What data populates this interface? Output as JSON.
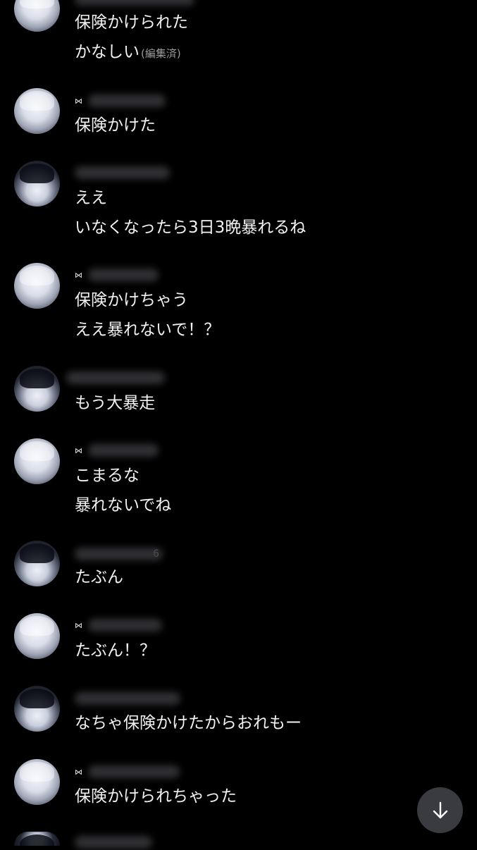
{
  "messages": [
    {
      "avatar": "light",
      "icon": "",
      "lines": [
        "保険かけられた",
        "かなしい"
      ],
      "edited": "(編集済)"
    },
    {
      "avatar": "light",
      "icon": "bowtie-icon",
      "lines": [
        "保険かけた"
      ]
    },
    {
      "avatar": "dark",
      "icon": "",
      "lines": [
        "ええ",
        "いなくなったら3日3晩暴れるね"
      ]
    },
    {
      "avatar": "light",
      "icon": "bowtie-icon",
      "lines": [
        "保険かけちゃう",
        "ええ暴れないで！？"
      ]
    },
    {
      "avatar": "dark",
      "icon": "",
      "lines": [
        "もう大暴走"
      ]
    },
    {
      "avatar": "light",
      "icon": "bowtie-icon",
      "lines": [
        "こまるな",
        "暴れないでね"
      ]
    },
    {
      "avatar": "dark",
      "icon": "",
      "name_suffix": "6",
      "lines": [
        "たぶん"
      ]
    },
    {
      "avatar": "light",
      "icon": "bowtie-icon",
      "lines": [
        "たぶん！？"
      ]
    },
    {
      "avatar": "dark",
      "icon": "",
      "lines": [
        "なちゃ保険かけたからおれもー"
      ]
    },
    {
      "avatar": "light",
      "icon": "bowtie-icon",
      "lines": [
        "保険かけられちゃった"
      ]
    },
    {
      "avatar": "dark",
      "icon": "",
      "lines": []
    }
  ],
  "scroll_button": {
    "icon": "arrow-down-icon"
  },
  "colors": {
    "background": "#000000",
    "text": "#f2f2f2",
    "edited": "#9a9a9a",
    "button": "#3a3b40"
  }
}
